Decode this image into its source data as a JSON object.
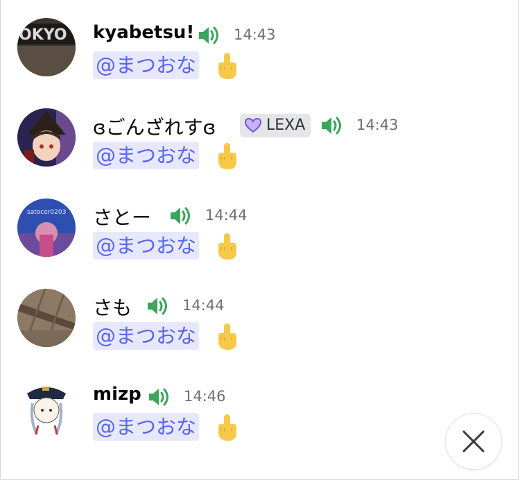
{
  "messages": [
    {
      "author": "kyabetsu!",
      "time": "14:43",
      "mention": "@まつおな",
      "avatar_text": "OKYO"
    },
    {
      "author": "ɞごんざれすɞ",
      "time": "14:43",
      "mention": "@まつおな",
      "tag": "LEXA"
    },
    {
      "author": "さとー",
      "time": "14:44",
      "mention": "@まつおな",
      "avatar_text": "satocer0203"
    },
    {
      "author": "さも",
      "time": "14:44",
      "mention": "@まつおな"
    },
    {
      "author": "mizp",
      "time": "14:46",
      "mention": "@まつおな"
    }
  ],
  "colors": {
    "mention_bg": "#e7e8fd",
    "mention_text": "#5865f2",
    "speaker": "#3ba55c",
    "time": "#6d6f78",
    "tag_heart": "#b08cff"
  },
  "icons": {
    "speaker": "speaker-icon",
    "emoji": "middle-finger-emoji",
    "close": "close-icon",
    "heart": "purple-heart-icon"
  }
}
